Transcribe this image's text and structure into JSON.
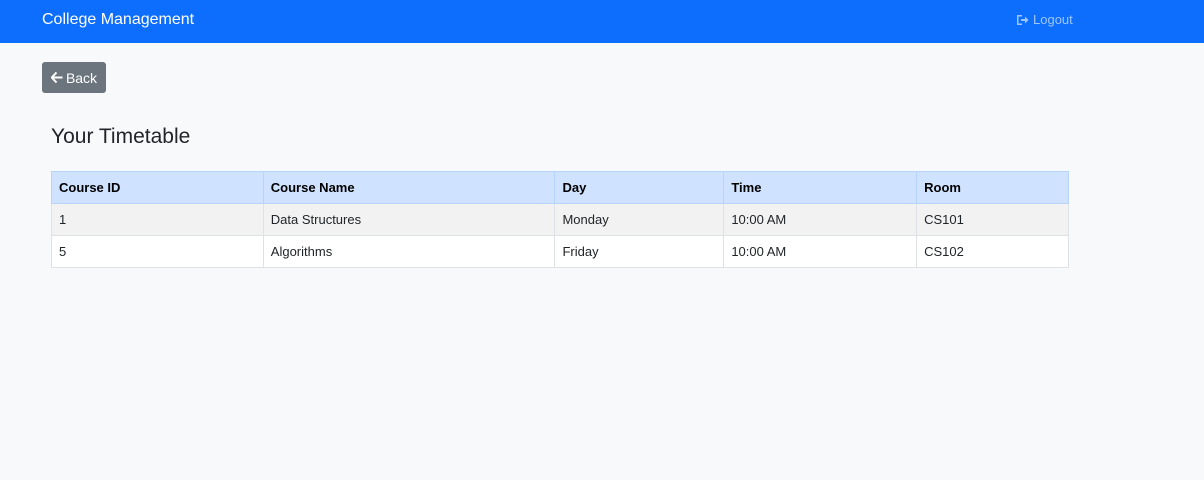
{
  "navbar": {
    "brand": "College Management",
    "logout_label": "Logout",
    "logout_icon": "sign-out-icon"
  },
  "back_button": {
    "label": "Back",
    "icon": "arrow-left-icon",
    "color": "#6c757d"
  },
  "page_title": "Your Timetable",
  "table": {
    "headers": [
      "Course ID",
      "Course Name",
      "Day",
      "Time",
      "Room"
    ],
    "rows": [
      [
        "1",
        "Data Structures",
        "Monday",
        "10:00 AM",
        "CS101"
      ],
      [
        "5",
        "Algorithms",
        "Friday",
        "10:00 AM",
        "CS102"
      ]
    ]
  },
  "colors": {
    "navbar": "#0d6efd",
    "header_row": "#cfe2ff",
    "page_background": "#f8f9fa"
  }
}
